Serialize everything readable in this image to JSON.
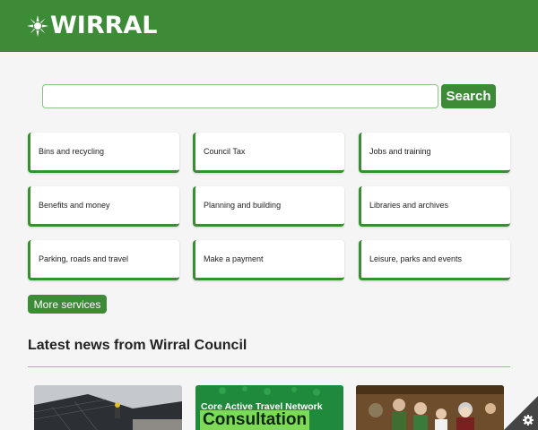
{
  "header": {
    "logo_text": "WIRRAL",
    "brand_color": "#3d8b37"
  },
  "search": {
    "value": "",
    "placeholder": "",
    "button_label": "Search"
  },
  "services": [
    {
      "label": "Bins and recycling"
    },
    {
      "label": "Council Tax"
    },
    {
      "label": "Jobs and training"
    },
    {
      "label": "Benefits and money"
    },
    {
      "label": "Planning and building"
    },
    {
      "label": "Libraries and archives"
    },
    {
      "label": "Parking, roads and travel"
    },
    {
      "label": "Make a payment"
    },
    {
      "label": "Leisure, parks and events"
    }
  ],
  "more_services_label": "More services",
  "news": {
    "heading": "Latest news from Wirral Council",
    "cards": [
      {
        "image": "rooftop-solar-workers"
      },
      {
        "image_text_1": "Core Active Travel Network",
        "image_text_2": "Consultation"
      },
      {
        "image": "puppet-show-performers"
      }
    ]
  },
  "settings": {
    "icon": "gear-icon"
  }
}
